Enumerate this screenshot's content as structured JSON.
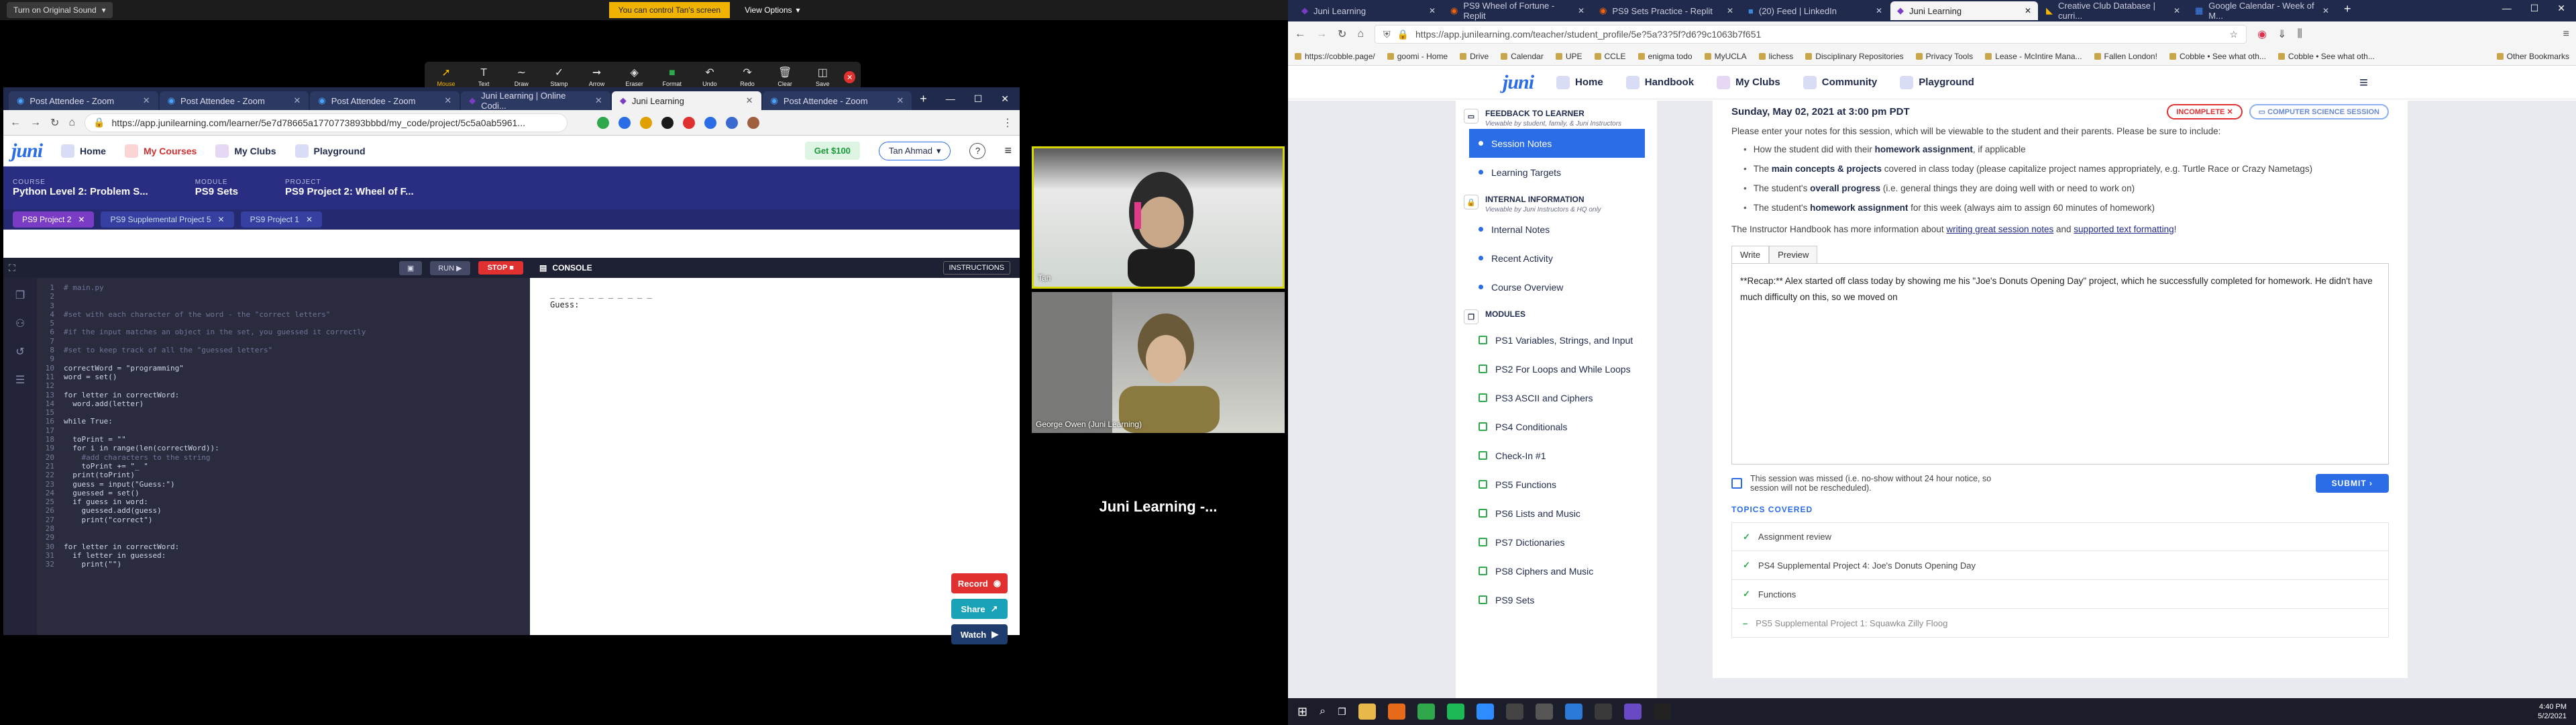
{
  "zoom": {
    "original_sound": "Turn on Original Sound",
    "control_msg": "You can control Tan's screen",
    "view_options": "View Options",
    "tools": [
      "Mouse",
      "Text",
      "Draw",
      "Stamp",
      "Arrow",
      "Eraser",
      "Format",
      "Undo",
      "Redo",
      "Clear",
      "Save"
    ]
  },
  "left_browser": {
    "tabs": [
      {
        "label": "Post Attendee - Zoom",
        "active": false
      },
      {
        "label": "Post Attendee - Zoom",
        "active": false
      },
      {
        "label": "Post Attendee - Zoom",
        "active": false
      },
      {
        "label": "Juni Learning | Online Codi...",
        "active": false
      },
      {
        "label": "Juni Learning",
        "active": true
      },
      {
        "label": "Post Attendee - Zoom",
        "active": false
      }
    ],
    "url": "https://app.junilearning.com/learner/5e7d78665a1770773893bbbd/my_code/project/5c5a0ab5961...",
    "nav": {
      "logo": "juni",
      "home": "Home",
      "my_courses": "My Courses",
      "my_clubs": "My Clubs",
      "playground": "Playground",
      "get100": "Get $100",
      "user": "Tan Ahmad"
    },
    "course": {
      "course_label": "COURSE",
      "course": "Python Level 2: Problem S...",
      "module_label": "MODULE",
      "module": "PS9 Sets",
      "project_label": "PROJECT",
      "project": "PS9 Project 2: Wheel of F..."
    },
    "project_tabs": [
      "PS9 Project 2",
      "PS9 Supplemental Project 5",
      "PS9 Project 1"
    ],
    "toolbar": {
      "run": "RUN",
      "stop": "STOP",
      "console": "CONSOLE",
      "instructions": "INSTRUCTIONS"
    },
    "code": [
      {
        "n": "1",
        "t": "# main.py",
        "c": true
      },
      {
        "n": "2",
        "t": "",
        "c": false
      },
      {
        "n": "3",
        "t": "",
        "c": false
      },
      {
        "n": "4",
        "t": "#set with each character of the word - the \"correct letters\"",
        "c": true
      },
      {
        "n": "5",
        "t": "",
        "c": false
      },
      {
        "n": "6",
        "t": "#if the input matches an object in the set, you guessed it correctly",
        "c": true
      },
      {
        "n": "7",
        "t": "",
        "c": false
      },
      {
        "n": "8",
        "t": "#set to keep track of all the \"guessed letters\"",
        "c": true
      },
      {
        "n": "9",
        "t": "",
        "c": false
      },
      {
        "n": "10",
        "t": "correctWord = \"programming\"",
        "c": false
      },
      {
        "n": "11",
        "t": "word = set()",
        "c": false
      },
      {
        "n": "12",
        "t": "",
        "c": false
      },
      {
        "n": "13",
        "t": "for letter in correctWord:",
        "c": false
      },
      {
        "n": "14",
        "t": "  word.add(letter)",
        "c": false
      },
      {
        "n": "15",
        "t": "",
        "c": false
      },
      {
        "n": "16",
        "t": "while True:",
        "c": false
      },
      {
        "n": "17",
        "t": "",
        "c": false
      },
      {
        "n": "18",
        "t": "  toPrint = \"\"",
        "c": false
      },
      {
        "n": "19",
        "t": "  for i in range(len(correctWord)):",
        "c": false
      },
      {
        "n": "20",
        "t": "    #add characters to the string",
        "c": true
      },
      {
        "n": "21",
        "t": "    toPrint += \"_ \"",
        "c": false
      },
      {
        "n": "22",
        "t": "  print(toPrint)",
        "c": false
      },
      {
        "n": "23",
        "t": "  guess = input(\"Guess:\")",
        "c": false
      },
      {
        "n": "24",
        "t": "  guessed = set()",
        "c": false
      },
      {
        "n": "25",
        "t": "  if guess in word:",
        "c": false
      },
      {
        "n": "26",
        "t": "    guessed.add(guess)",
        "c": false
      },
      {
        "n": "27",
        "t": "    print(\"correct\")",
        "c": false
      },
      {
        "n": "28",
        "t": "",
        "c": false
      },
      {
        "n": "29",
        "t": "",
        "c": false
      },
      {
        "n": "30",
        "t": "for letter in correctWord:",
        "c": false
      },
      {
        "n": "31",
        "t": "  if letter in guessed:",
        "c": false
      },
      {
        "n": "32",
        "t": "    print(\"\")",
        "c": false
      }
    ],
    "console_output": "_ _ _ _ _ _ _ _ _ _ _\nGuess:",
    "buttons": {
      "record": "Record",
      "share": "Share",
      "watch": "Watch"
    }
  },
  "videos": {
    "v1_label": "Tan",
    "v2_label": "George Owen (Juni Learning)",
    "v3_name": "Juni Learning -..."
  },
  "right_browser": {
    "tabs": [
      {
        "label": "Juni Learning",
        "active": false
      },
      {
        "label": "PS9 Wheel of Fortune - Replit",
        "active": false
      },
      {
        "label": "PS9 Sets Practice - Replit",
        "active": false
      },
      {
        "label": "(20) Feed | LinkedIn",
        "active": false
      },
      {
        "label": "Juni Learning",
        "active": true
      },
      {
        "label": "Creative Club Database | curri...",
        "active": false
      },
      {
        "label": "Google Calendar - Week of M...",
        "active": false
      }
    ],
    "url": "https://app.junilearning.com/teacher/student_profile/5e?5a?3?5f?d6?9c1063b7f651",
    "bookmarks": [
      "https://cobble.page/",
      "goomi - Home",
      "Drive",
      "Calendar",
      "UPE",
      "CCLE",
      "enigma todo",
      "MyUCLA",
      "lichess",
      "Disciplinary Repositories",
      "Privacy Tools",
      "Lease - McIntire Mana...",
      "Fallen London!",
      "Cobble • See what oth...",
      "Cobble • See what oth...",
      "Other Bookmarks"
    ],
    "nav": {
      "logo": "juni",
      "home": "Home",
      "handbook": "Handbook",
      "my_clubs": "My Clubs",
      "community": "Community",
      "playground": "Playground"
    },
    "sidebar": {
      "feedback_title": "FEEDBACK TO LEARNER",
      "feedback_sub": "Viewable by student, family, & Juni Instructors",
      "feedback_items": [
        "Session Notes",
        "Learning Targets"
      ],
      "internal_title": "INTERNAL INFORMATION",
      "internal_sub": "Viewable by Juni Instructors & HQ only",
      "internal_items": [
        "Internal Notes",
        "Recent Activity",
        "Course Overview"
      ],
      "modules_title": "MODULES",
      "modules": [
        "PS1 Variables, Strings, and Input",
        "PS2 For Loops and While Loops",
        "PS3 ASCII and Ciphers",
        "PS4 Conditionals",
        "Check-In #1",
        "PS5 Functions",
        "PS6 Lists and Music",
        "PS7 Dictionaries",
        "PS8 Ciphers and Music",
        "PS9 Sets"
      ]
    },
    "main": {
      "date": "Sunday, May 02, 2021 at 3:00 pm PDT",
      "incomplete": "INCOMPLETE",
      "session": "COMPUTER SCIENCE SESSION",
      "intro": "Please enter your notes for this session, which will be viewable to the student and their parents. Please be sure to include:",
      "bullets": [
        {
          "pre": "How the student did with their ",
          "bold": "homework assignment",
          "post": ", if applicable"
        },
        {
          "pre": "The ",
          "bold": "main concepts & projects",
          "post": " covered in class today (please capitalize project names appropriately, e.g. Turtle Race or Crazy Nametags)"
        },
        {
          "pre": "The student's ",
          "bold": "overall progress",
          "post": " (i.e. general things they are doing well with or need to work on)"
        },
        {
          "pre": "The student's ",
          "bold": "homework assignment",
          "post": " for this week (always aim to assign 60 minutes of homework)"
        }
      ],
      "handbook_pre": "The Instructor Handbook has more information about ",
      "handbook_link1": "writing great session notes",
      "handbook_mid": " and ",
      "handbook_link2": "supported text formatting",
      "handbook_post": "!",
      "write_tab": "Write",
      "preview_tab": "Preview",
      "notes": "**Recap:** Alex started off class today by showing me his \"Joe's Donuts Opening Day\" project, which he successfully completed for homework. He didn't have much difficulty on this, so we moved on",
      "missed": "This session was missed (i.e. no-show without 24 hour notice, so session will not be rescheduled).",
      "submit": "SUBMIT",
      "topics_title": "TOPICS COVERED",
      "topics": [
        {
          "label": "Assignment review",
          "checked": true
        },
        {
          "label": "PS4 Supplemental Project 4: Joe's Donuts Opening Day",
          "checked": true
        },
        {
          "label": "Functions",
          "checked": true
        },
        {
          "label": "PS5 Supplemental Project 1: Squawka Zilly Floog",
          "checked": false
        }
      ]
    }
  },
  "taskbar": {
    "time": "4:40 PM",
    "date": "5/2/2021"
  },
  "colors": {
    "juni_blue": "#2b6de6",
    "course_bar": "#2a2e83",
    "stop_red": "#e03030",
    "record_red": "#e03030",
    "share_teal": "#1aa3b8",
    "watch_navy": "#1f3c6e",
    "speaker_border": "#d8d800"
  }
}
